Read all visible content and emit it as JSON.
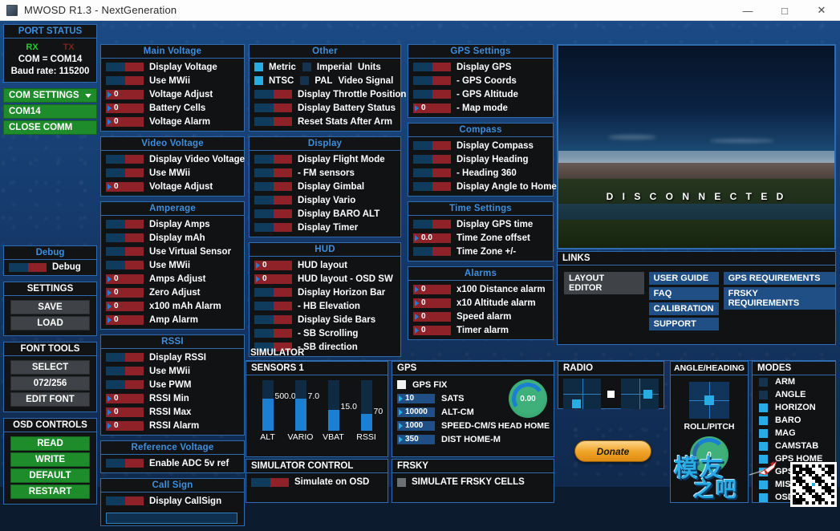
{
  "window": {
    "title": "MWOSD R1.3 - NextGeneration",
    "minimize": "—",
    "maximize": "□",
    "close": "✕"
  },
  "sidebar": {
    "port_status": {
      "title": "PORT STATUS",
      "rx": "RX",
      "tx": "TX",
      "com": "COM = COM14",
      "baud": "Baud rate: 115200"
    },
    "com_settings": {
      "label": "COM SETTINGS",
      "selected_port": "COM14",
      "close_comm": "CLOSE COMM"
    },
    "debug": {
      "title": "Debug",
      "label": "Debug"
    },
    "settings": {
      "title": "SETTINGS",
      "save": "SAVE",
      "load": "LOAD"
    },
    "font_tools": {
      "title": "FONT TOOLS",
      "select": "SELECT",
      "counter": "072/256",
      "edit_font": "EDIT FONT"
    },
    "osd_controls": {
      "title": "OSD CONTROLS",
      "read": "READ",
      "write": "WRITE",
      "default": "DEFAULT",
      "restart": "RESTART"
    }
  },
  "main_voltage": {
    "title": "Main Voltage",
    "items": [
      {
        "label": "Display Voltage",
        "type": "toggle"
      },
      {
        "label": "Use MWii",
        "type": "toggle"
      },
      {
        "label": "Voltage Adjust",
        "type": "spin",
        "value": "0"
      },
      {
        "label": "Battery Cells",
        "type": "spin",
        "value": "0"
      },
      {
        "label": "Voltage Alarm",
        "type": "spin",
        "value": "0"
      }
    ]
  },
  "video_voltage": {
    "title": "Video Voltage",
    "items": [
      {
        "label": "Display Video Voltage",
        "type": "toggle"
      },
      {
        "label": "Use MWii",
        "type": "toggle"
      },
      {
        "label": "Voltage Adjust",
        "type": "spin",
        "value": "0"
      }
    ]
  },
  "amperage": {
    "title": "Amperage",
    "items": [
      {
        "label": "Display Amps",
        "type": "toggle"
      },
      {
        "label": "Display mAh",
        "type": "toggle"
      },
      {
        "label": "Use Virtual Sensor",
        "type": "toggle"
      },
      {
        "label": "Use MWii",
        "type": "toggle"
      },
      {
        "label": "Amps Adjust",
        "type": "spin",
        "value": "0"
      },
      {
        "label": "Zero Adjust",
        "type": "spin",
        "value": "0"
      },
      {
        "label": "x100 mAh Alarm",
        "type": "spin",
        "value": "0"
      },
      {
        "label": "Amp Alarm",
        "type": "spin",
        "value": "0"
      }
    ]
  },
  "rssi": {
    "title": "RSSI",
    "items": [
      {
        "label": "Display RSSI",
        "type": "toggle"
      },
      {
        "label": "Use MWii",
        "type": "toggle"
      },
      {
        "label": "Use PWM",
        "type": "toggle"
      },
      {
        "label": "RSSI Min",
        "type": "spin",
        "value": "0"
      },
      {
        "label": "RSSI Max",
        "type": "spin",
        "value": "0"
      },
      {
        "label": "RSSI Alarm",
        "type": "spin",
        "value": "0"
      }
    ]
  },
  "reference_voltage": {
    "title": "Reference Voltage",
    "items": [
      {
        "label": "Enable ADC 5v ref",
        "type": "toggle"
      }
    ]
  },
  "call_sign": {
    "title": "Call Sign",
    "items": [
      {
        "label": "Display CallSign",
        "type": "toggle"
      }
    ],
    "input_value": ""
  },
  "other": {
    "title": "Other",
    "units_row": {
      "metric": "Metric",
      "imperial": "Imperial",
      "label": "Units",
      "metric_checked": true,
      "imperial_checked": false
    },
    "video_row": {
      "ntsc": "NTSC",
      "pal": "PAL",
      "label": "Video Signal",
      "ntsc_checked": true,
      "pal_checked": false
    },
    "items": [
      {
        "label": "Display Throttle Position",
        "type": "toggle"
      },
      {
        "label": "Display Battery Status",
        "type": "toggle"
      },
      {
        "label": "Reset Stats After Arm",
        "type": "toggle"
      }
    ]
  },
  "display": {
    "title": "Display",
    "items": [
      {
        "label": "Display Flight Mode",
        "type": "toggle"
      },
      {
        "label": " - FM sensors",
        "type": "toggle"
      },
      {
        "label": "Display Gimbal",
        "type": "toggle"
      },
      {
        "label": "Display Vario",
        "type": "toggle"
      },
      {
        "label": "Display BARO ALT",
        "type": "toggle"
      },
      {
        "label": "Display Timer",
        "type": "toggle"
      }
    ]
  },
  "hud": {
    "title": "HUD",
    "items": [
      {
        "label": "HUD layout",
        "type": "spin",
        "value": "0"
      },
      {
        "label": "HUD layout - OSD SW",
        "type": "spin",
        "value": "0"
      },
      {
        "label": "Display Horizon Bar",
        "type": "toggle"
      },
      {
        "label": " - HB Elevation",
        "type": "toggle"
      },
      {
        "label": "Display Side Bars",
        "type": "toggle"
      },
      {
        "label": " - SB Scrolling",
        "type": "toggle"
      },
      {
        "label": " - SB direction",
        "type": "toggle"
      }
    ]
  },
  "gps_settings": {
    "title": "GPS Settings",
    "items": [
      {
        "label": "Display GPS",
        "type": "toggle"
      },
      {
        "label": " - GPS Coords",
        "type": "toggle"
      },
      {
        "label": " - GPS Altitude",
        "type": "toggle"
      },
      {
        "label": " - Map mode",
        "type": "spin",
        "value": "0"
      }
    ]
  },
  "compass": {
    "title": "Compass",
    "items": [
      {
        "label": "Display Compass",
        "type": "toggle"
      },
      {
        "label": "Display Heading",
        "type": "toggle"
      },
      {
        "label": " - Heading 360",
        "type": "toggle"
      },
      {
        "label": "Display Angle to Home",
        "type": "toggle"
      }
    ]
  },
  "time_settings": {
    "title": "Time Settings",
    "items": [
      {
        "label": "Display GPS time",
        "type": "toggle"
      },
      {
        "label": "Time Zone offset",
        "type": "spin",
        "value": "0.0"
      },
      {
        "label": "Time Zone +/-",
        "type": "toggle"
      }
    ]
  },
  "alarms": {
    "title": "Alarms",
    "items": [
      {
        "label": "x100 Distance alarm",
        "type": "spin",
        "value": "0"
      },
      {
        "label": "x10   Altitude alarm",
        "type": "spin",
        "value": "0"
      },
      {
        "label": "Speed alarm",
        "type": "spin",
        "value": "0"
      },
      {
        "label": "Timer alarm",
        "type": "spin",
        "value": "0"
      }
    ]
  },
  "video_preview": {
    "status": "D I S C O N N E C T E D"
  },
  "links": {
    "title": "LINKS",
    "col1": [
      "LAYOUT EDITOR"
    ],
    "col2": [
      "USER GUIDE",
      "FAQ",
      "CALIBRATION",
      "SUPPORT"
    ],
    "col3": [
      "GPS REQUIREMENTS",
      "FRSKY REQUIREMENTS"
    ]
  },
  "simulator": {
    "title": "SIMULATOR",
    "sensors": {
      "title": "SENSORS 1",
      "sliders": [
        {
          "name": "ALT",
          "value": "500.0",
          "fill_pct": 63
        },
        {
          "name": "VARIO",
          "value": "7.0",
          "fill_pct": 63
        },
        {
          "name": "VBAT",
          "value": "15.0",
          "fill_pct": 42
        },
        {
          "name": "RSSI",
          "value": "70",
          "fill_pct": 33
        }
      ]
    },
    "control": {
      "title": "SIMULATOR CONTROL",
      "label": "Simulate on OSD"
    },
    "gps": {
      "title": "GPS",
      "fix_label": "GPS FIX",
      "fix_checked": true,
      "rows": [
        {
          "value": "10",
          "label": "SATS"
        },
        {
          "value": "10000",
          "label": "ALT-CM"
        },
        {
          "value": "1000",
          "label": "SPEED-CM/S"
        },
        {
          "value": "350",
          "label": "DIST HOME-M"
        }
      ],
      "head_home_value": "0.00",
      "head_home_label": "HEAD HOME"
    },
    "frsky": {
      "title": "FRSKY",
      "label": "SIMULATE FRSKY CELLS",
      "checked": false
    },
    "radio": {
      "title": "RADIO"
    },
    "donate": "Donate",
    "angle_heading": {
      "title": "ANGLE/HEADING",
      "roll_pitch_label": "ROLL/PITCH",
      "heading_value": "0"
    },
    "modes": {
      "title": "MODES",
      "items": [
        {
          "label": "ARM",
          "checked": false
        },
        {
          "label": "ANGLE",
          "checked": false
        },
        {
          "label": "HORIZON",
          "checked": true
        },
        {
          "label": "BARO",
          "checked": true
        },
        {
          "label": "MAG",
          "checked": true
        },
        {
          "label": "CAMSTAB",
          "checked": true
        },
        {
          "label": "GPS HOME",
          "checked": true
        },
        {
          "label": "GPS HOLD",
          "checked": true
        },
        {
          "label": "MISSION",
          "checked": true
        },
        {
          "label": "OSD SW",
          "checked": true
        }
      ]
    }
  },
  "watermark": {
    "line1": "模友",
    "line2": "之吧"
  },
  "colors": {
    "accent_blue": "#3d8fe0",
    "toggle_blue": "#0f3b5c",
    "toggle_red": "#8f2229",
    "green_button": "#1e8c2a",
    "checkbox_on": "#29ace3",
    "donate_orange": "#f0a62a"
  }
}
